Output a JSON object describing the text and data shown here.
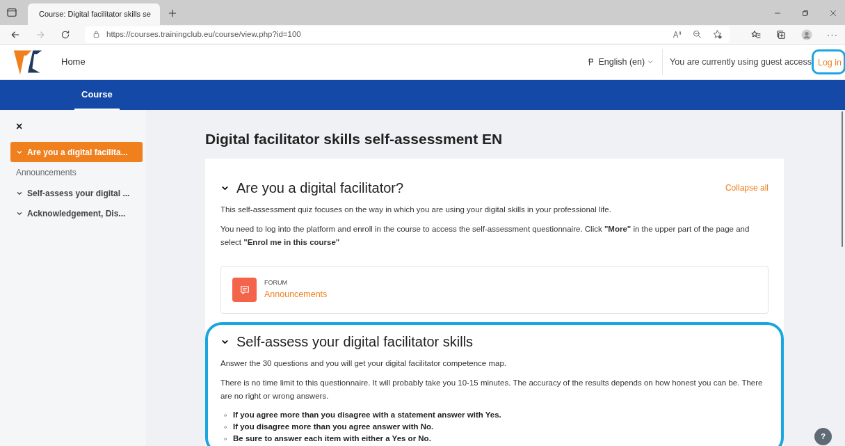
{
  "browser": {
    "tab_title": "Course: Digital facilitator skills se",
    "url": "https://courses.trainingclub.eu/course/view.php?id=100",
    "more": "···"
  },
  "header": {
    "home": "Home",
    "language": "English (en)",
    "guest_notice": "You are currently using guest access",
    "login": "Log in"
  },
  "nav": [
    {
      "label": "Course",
      "selected": true
    }
  ],
  "sidebar": {
    "close": "×",
    "items": [
      {
        "label": "Are you a digital facilita...",
        "selected": true,
        "expanded": true,
        "children": [
          {
            "label": "Announcements"
          }
        ]
      },
      {
        "label": "Self-assess your digital ...",
        "selected": false,
        "expanded": true
      },
      {
        "label": "Acknowledgement, Dis...",
        "selected": false,
        "expanded": true
      }
    ]
  },
  "page_title": "Digital facilitator skills self-assessment EN",
  "collapse_all": "Collapse all",
  "sections": [
    {
      "title": "Are you a digital facilitator?",
      "expanded": true,
      "highlighted": false,
      "paragraphs": [
        "This self-assessment quiz focuses on the way in which you are using your digital skills in your professional life.",
        "You need to log into the platform and enroll in the course to access the self-assessment questionnaire. Click **\"More\"** in the upper part of the page and select **\"Enrol me in this course\"**"
      ],
      "activities": [
        {
          "type": "FORUM",
          "name": "Announcements"
        }
      ]
    },
    {
      "title": "Self-assess your digital facilitator skills",
      "expanded": true,
      "highlighted": true,
      "paragraphs": [
        "Answer the 30 questions and you will get your digital facilitator competence map.",
        "There is no time limit to this questionnaire. It will probably take you 10-15 minutes. The accuracy of the results depends on how honest you can be. There are no right or wrong answers."
      ],
      "bullets": [
        "If you agree more than you disagree with a statement answer with Yes.",
        "If you disagree more than you agree answer with No.",
        "Be sure to answer each item with either a Yes or No."
      ]
    }
  ],
  "help": "?"
}
